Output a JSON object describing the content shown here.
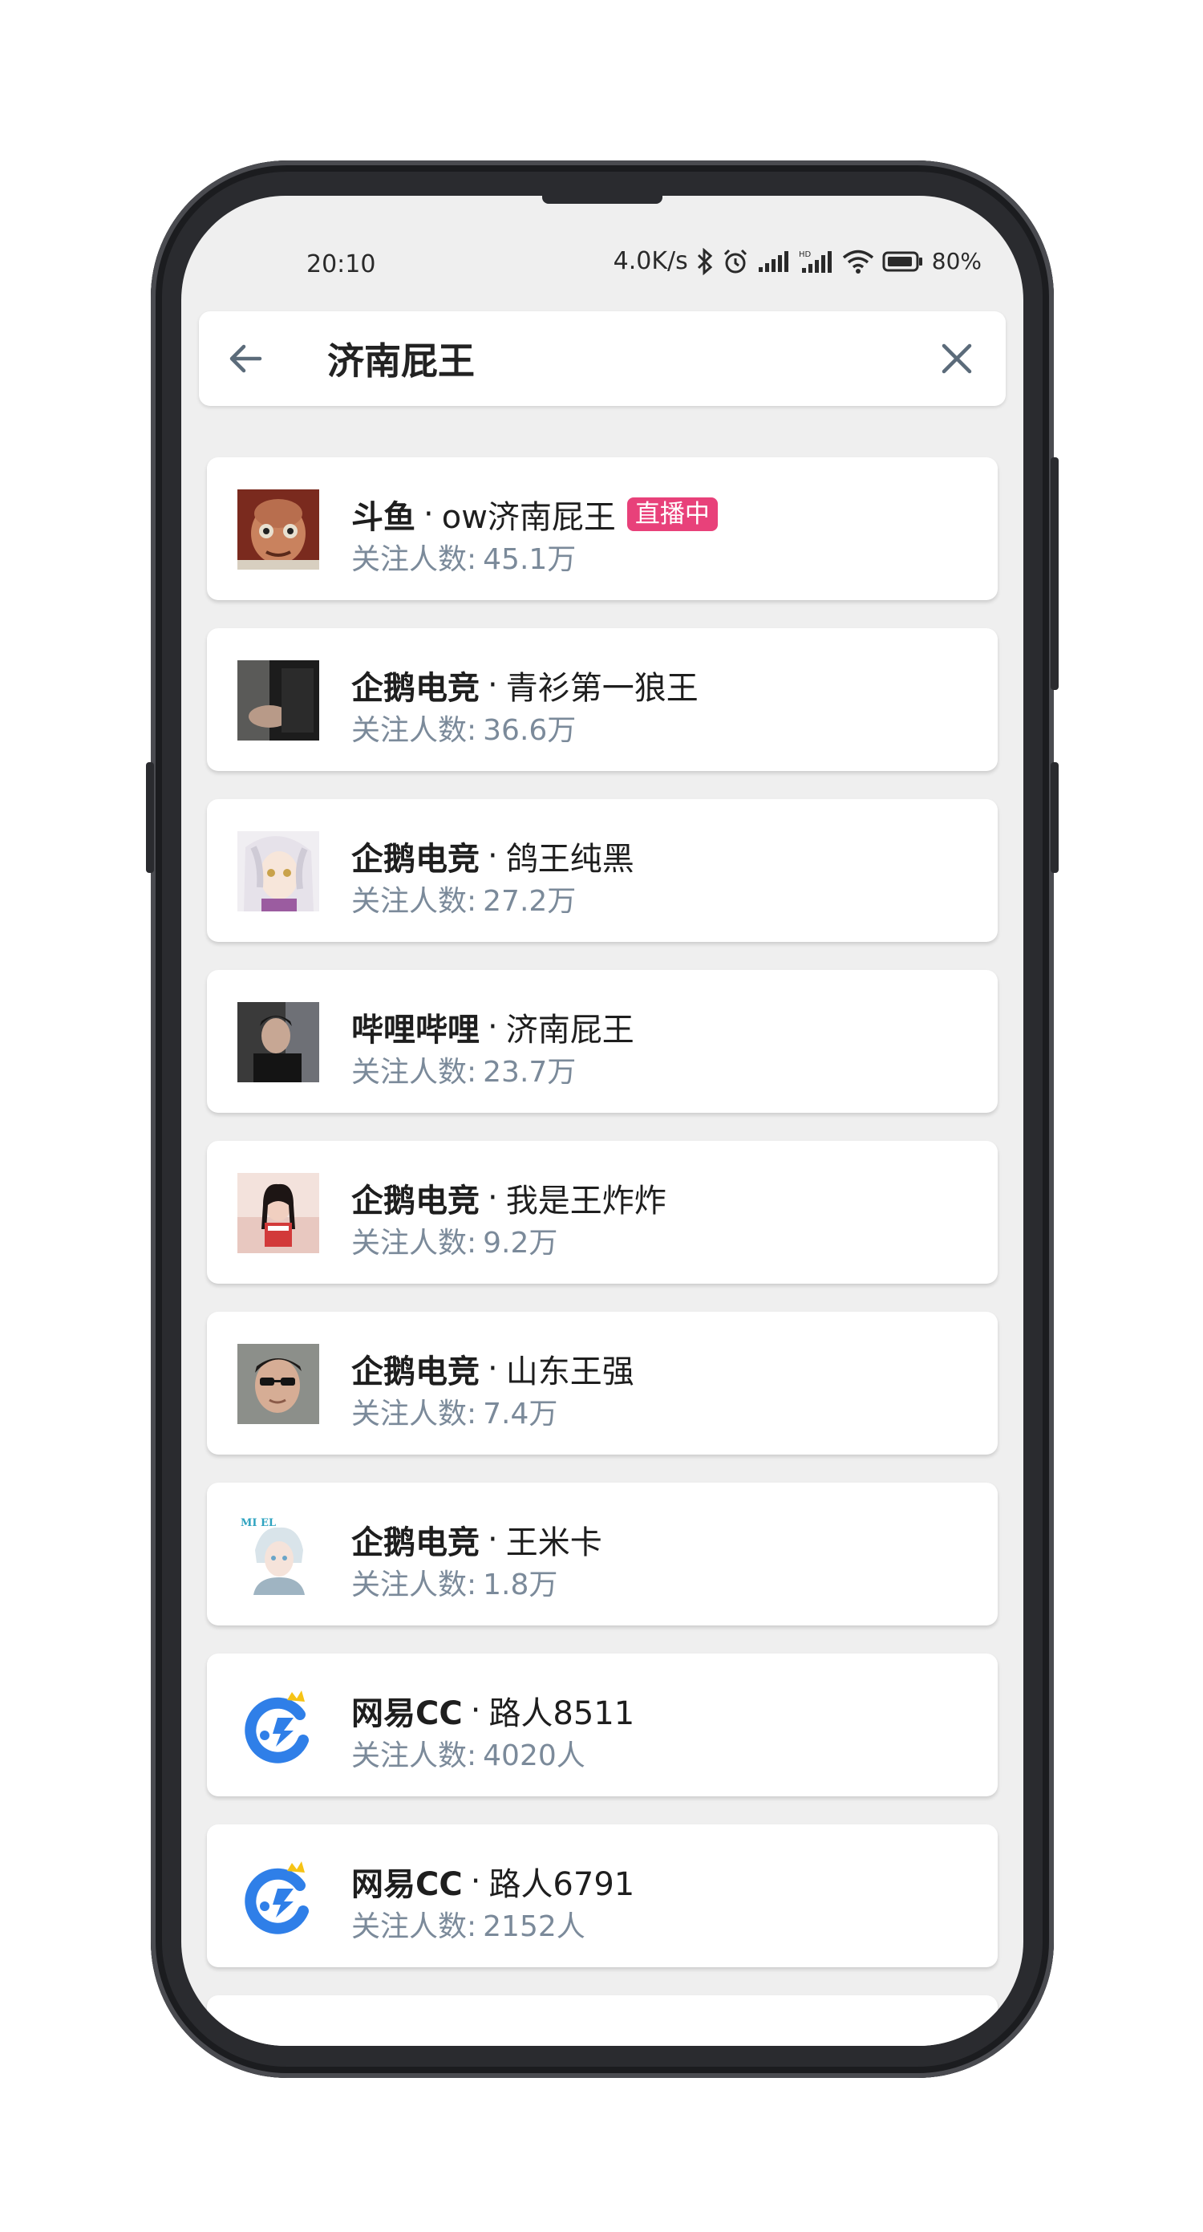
{
  "status_bar": {
    "time": "20:10",
    "net_speed": "4.0K/s",
    "battery": "80%"
  },
  "search": {
    "query": "济南屁王",
    "back_icon": "arrow-left-icon",
    "clear_icon": "close-icon"
  },
  "results": [
    {
      "platform": "斗鱼",
      "name": "ow济南屁王",
      "followers_label": "关注人数:",
      "followers": "45.1万",
      "live": "直播中",
      "avatar": "character-portrait"
    },
    {
      "platform": "企鹅电竞",
      "name": "青衫第一狼王",
      "followers_label": "关注人数:",
      "followers": "36.6万",
      "avatar": "dark-photo"
    },
    {
      "platform": "企鹅电竞",
      "name": "鸽王纯黑",
      "followers_label": "关注人数:",
      "followers": "27.2万",
      "avatar": "anime-portrait"
    },
    {
      "platform": "哔哩哔哩",
      "name": "济南屁王",
      "followers_label": "关注人数:",
      "followers": "23.7万",
      "avatar": "person-photo"
    },
    {
      "platform": "企鹅电竞",
      "name": "我是王炸炸",
      "followers_label": "关注人数:",
      "followers": "9.2万",
      "avatar": "girl-photo"
    },
    {
      "platform": "企鹅电竞",
      "name": "山东王强",
      "followers_label": "关注人数:",
      "followers": "7.4万",
      "avatar": "man-sunglasses-photo"
    },
    {
      "platform": "企鹅电竞",
      "name": "王米卡",
      "followers_label": "关注人数:",
      "followers": "1.8万",
      "avatar": "anime-boy-portrait"
    },
    {
      "platform": "网易CC",
      "name": "路人8511",
      "followers_label": "关注人数:",
      "followers": "4020人",
      "avatar": "cc-logo"
    },
    {
      "platform": "网易CC",
      "name": "路人6791",
      "followers_label": "关注人数:",
      "followers": "2152人",
      "avatar": "cc-logo"
    }
  ],
  "colors": {
    "live_badge": "#e8417a",
    "subtitle": "#7b8a9a",
    "background": "#efefef"
  }
}
